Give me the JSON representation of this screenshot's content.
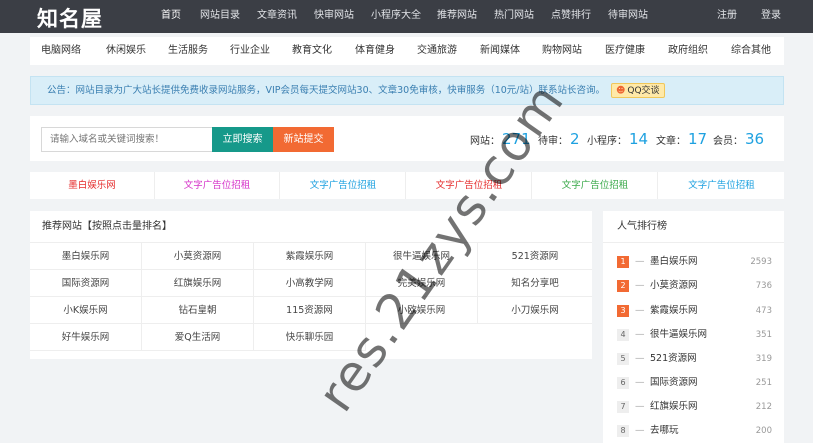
{
  "header": {
    "logo": "知名屋",
    "nav": [
      "首页",
      "网站目录",
      "文章资讯",
      "快审网站",
      "小程序大全",
      "推荐网站",
      "热门网站",
      "点赞排行",
      "待审网站"
    ],
    "register": "注册",
    "login": "登录"
  },
  "categories": [
    "电脑网络",
    "休闲娱乐",
    "生活服务",
    "行业企业",
    "教育文化",
    "体育健身",
    "交通旅游",
    "新闻媒体",
    "购物网站",
    "医疗健康",
    "政府组织",
    "综合其他"
  ],
  "notice": {
    "text": "公告：网站目录为广大站长提供免费收录网站服务，VIP会员每天提交网站30、文章30免审核，快审服务（10元/站）联系站长咨询。",
    "qq_label": "QQ交谈"
  },
  "search": {
    "placeholder": "请输入域名或关键词搜索！",
    "search_label": "立即搜索",
    "submit_label": "新站提交"
  },
  "stats": [
    {
      "label": "网站：",
      "value": "271"
    },
    {
      "label": "待审：",
      "value": "2"
    },
    {
      "label": "小程序：",
      "value": "14"
    },
    {
      "label": "文章：",
      "value": "17"
    },
    {
      "label": "会员：",
      "value": "36"
    }
  ],
  "ads": [
    {
      "text": "墨白娱乐网",
      "color": "#e52e2e"
    },
    {
      "text": "文字广告位招租",
      "color": "#d634c9"
    },
    {
      "text": "文字广告位招租",
      "color": "#1ea1e0"
    },
    {
      "text": "文字广告位招租",
      "color": "#e52e2e"
    },
    {
      "text": "文字广告位招租",
      "color": "#3aa94a"
    },
    {
      "text": "文字广告位招租",
      "color": "#1ea1e0"
    }
  ],
  "recommend": {
    "title": "推荐网站【按照点击量排名】",
    "sites": [
      "墨白娱乐网",
      "小莫资源网",
      "紫霞娱乐网",
      "很牛逼娱乐网",
      "521资源网",
      "国际资源网",
      "红旗娱乐网",
      "小高教学网",
      "完美娱乐网",
      "知名分享吧",
      "小K娱乐网",
      "钻石皇朝",
      "115资源网",
      "小欧娱乐网",
      "小刀娱乐网",
      "好牛娱乐网",
      "爱Q生活网",
      "快乐聊乐园"
    ]
  },
  "ranking": {
    "title": "人气排行榜",
    "items": [
      {
        "num": "1",
        "name": "墨白娱乐网",
        "count": "2593"
      },
      {
        "num": "2",
        "name": "小莫资源网",
        "count": "736"
      },
      {
        "num": "3",
        "name": "紫霞娱乐网",
        "count": "473"
      },
      {
        "num": "4",
        "name": "很牛逼娱乐网",
        "count": "351"
      },
      {
        "num": "5",
        "name": "521资源网",
        "count": "319"
      },
      {
        "num": "6",
        "name": "国际资源网",
        "count": "251"
      },
      {
        "num": "7",
        "name": "红旗娱乐网",
        "count": "212"
      },
      {
        "num": "8",
        "name": "去哪玩",
        "count": "200"
      }
    ]
  },
  "watermark": "res.21zys.com"
}
